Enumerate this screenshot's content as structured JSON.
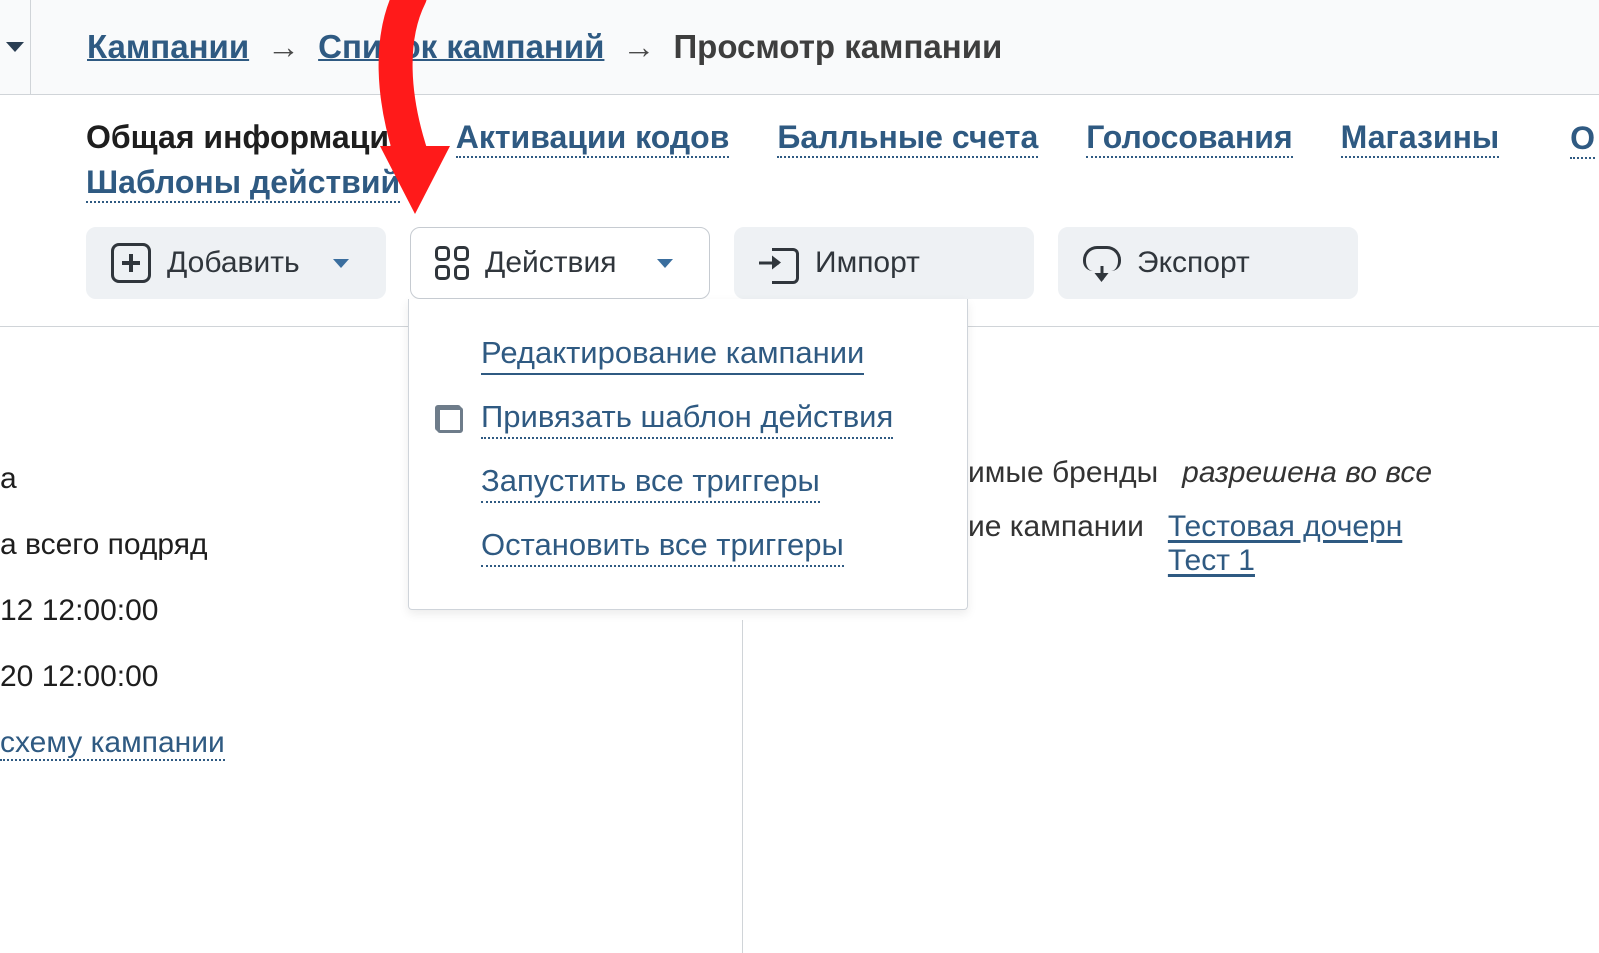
{
  "breadcrumb": {
    "link1": "Кампании",
    "link2": "Список кампаний",
    "current": "Просмотр кампании",
    "arrow": "→"
  },
  "tabs": {
    "active": "Общая информация",
    "items": [
      "Активации кодов",
      "Балльные счета",
      "Голосования",
      "Магазины"
    ],
    "cut_right": "О",
    "row2": "Шаблоны действий"
  },
  "buttons": {
    "add": "Добавить",
    "actions": "Действия",
    "import": "Импорт",
    "export": "Экспорт"
  },
  "actions_menu": {
    "edit": "Редактирование кампании",
    "bind_template": "Привязать шаблон действия",
    "start_triggers": "Запустить все триггеры",
    "stop_triggers": "Остановить все триггеры"
  },
  "left_partial": {
    "l1": "",
    "l2": "а",
    "l3": "а всего подряд",
    "l4": "12 12:00:00",
    "l5": "20 12:00:00",
    "l6": "схему кампании"
  },
  "right_partial": {
    "brands_label": "имые бренды",
    "brands_value": "разрешена во всe",
    "campaigns_label": "ие кампании",
    "child_link": "Тестовая дочерн",
    "test_link": "Тест 1"
  }
}
